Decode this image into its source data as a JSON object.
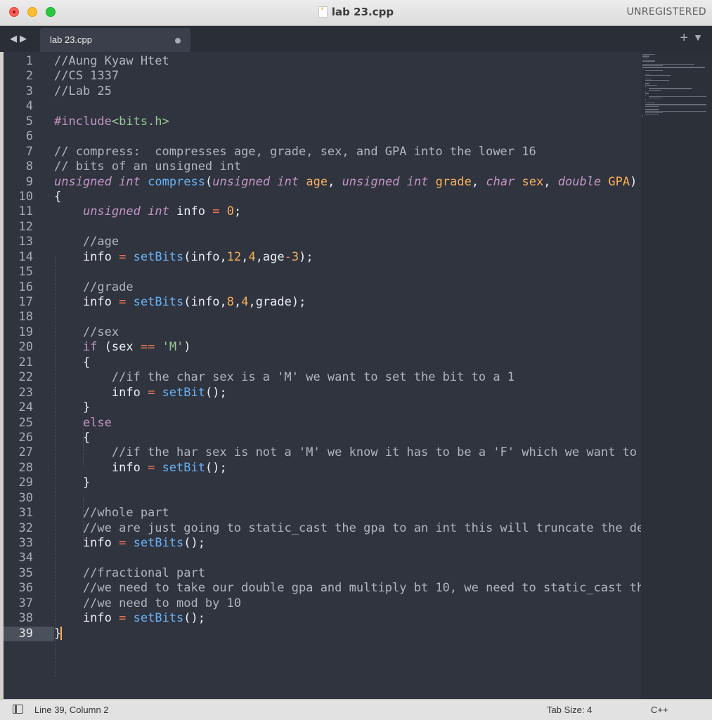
{
  "window": {
    "title": "lab 23.cpp",
    "registration": "UNREGISTERED"
  },
  "tab": {
    "label": "lab 23.cpp"
  },
  "status": {
    "position": "Line 39, Column 2",
    "tab_size": "Tab Size: 4",
    "syntax": "C++"
  },
  "editor": {
    "current_line": 39,
    "lines": [
      "//Aung Kyaw Htet",
      "//CS 1337",
      "//Lab 25",
      "",
      "#include<bits.h>",
      "",
      "// compress:  compresses age, grade, sex, and GPA into the lower 16",
      "// bits of an unsigned int",
      "unsigned int compress(unsigned int age, unsigned int grade, char sex, double GPA)",
      "{",
      "    unsigned int info = 0;",
      "",
      "    //age",
      "    info = setBits(info,12,4,age-3);",
      "",
      "    //grade",
      "    info = setBits(info,8,4,grade);",
      "",
      "    //sex",
      "    if (sex == 'M')",
      "    {",
      "        //if the char sex is a 'M' we want to set the bit to a 1",
      "        info = setBit();",
      "    }",
      "    else",
      "    {",
      "        //if the har sex is not a 'M' we know it has to be a 'F' which we want to s",
      "        info = setBit();",
      "    }",
      "",
      "    //whole part",
      "    //we are just going to static_cast the gpa to an int this will truncate the dec",
      "    info = setBits();",
      "",
      "    //fractional part",
      "    //we need to take our double gpa and multiply bt 10, we need to static_cast thi",
      "    //we need to mod by 10",
      "    info = setBits();",
      "}"
    ]
  },
  "colors": {
    "background": "#2f343f",
    "comment": "#b0b5be",
    "keyword": "#c594c5",
    "function": "#6ab0f3",
    "parameter": "#f9ae58",
    "operator": "#f97b58",
    "string": "#99c794"
  }
}
